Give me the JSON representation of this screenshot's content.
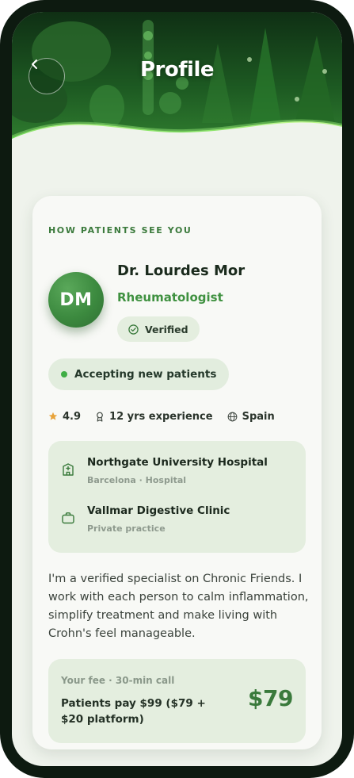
{
  "header": {
    "title": "Profile",
    "back_icon": "chevron-left-icon"
  },
  "card": {
    "section_label": "HOW PATIENTS SEE YOU",
    "avatar_initials": "DM",
    "doctor_name": "Dr. Lourdes Mor",
    "specialty": "Rheumatologist",
    "verified_label": "Verified",
    "accepting_label": "Accepting new patients",
    "stats": {
      "rating": "4.9",
      "experience": "12 yrs experience",
      "country": "Spain"
    },
    "locations": [
      {
        "name": "Northgate University Hospital",
        "detail": "Barcelona · Hospital",
        "icon": "hospital-icon"
      },
      {
        "name": "Vallmar Digestive Clinic",
        "detail": "Private practice",
        "icon": "briefcase-icon"
      }
    ],
    "bio": "I'm a verified specialist on Chronic Friends. I work with each person to calm inflammation, simplify treatment and make living with Crohn's feel manageable.",
    "fee": {
      "label": "Your fee · 30-min call",
      "description": "Patients pay $99 ($79 + $20 platform)",
      "price": "$79"
    }
  },
  "colors": {
    "accent_green": "#3f9140",
    "badge_bg": "#e4eedf",
    "star": "#e8a33a",
    "status_dot": "#3fae45"
  }
}
